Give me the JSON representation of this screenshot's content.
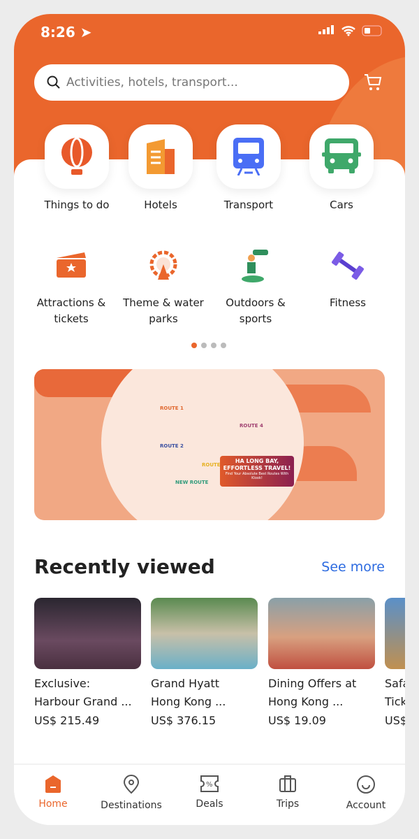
{
  "status": {
    "time": "8:26"
  },
  "search": {
    "placeholder": "Activities, hotels, transport..."
  },
  "categories": [
    {
      "label": "Things to do",
      "icon": "hot-air-balloon-icon"
    },
    {
      "label": "Hotels",
      "icon": "building-icon"
    },
    {
      "label": "Transport",
      "icon": "train-icon"
    },
    {
      "label": "Cars",
      "icon": "car-icon"
    }
  ],
  "subcategories": [
    {
      "label": "Attractions & tickets",
      "icon": "ticket-icon"
    },
    {
      "label": "Theme & water parks",
      "icon": "ferris-wheel-icon"
    },
    {
      "label": "Outdoors & sports",
      "icon": "binoculars-icon"
    },
    {
      "label": "Fitness",
      "icon": "dumbbell-icon"
    }
  ],
  "carousel": {
    "pages": 4,
    "active": 0
  },
  "banner": {
    "route1": "ROUTE 1",
    "route2": "ROUTE 2",
    "route3": "ROUTE 3",
    "route4": "ROUTE 4",
    "new_route": "NEW ROUTE",
    "headline": "HA LONG BAY, EFFORTLESS TRAVEL!",
    "subline": "Find Your Absolute Best Routes With Klook!"
  },
  "recent": {
    "title": "Recently viewed",
    "see_more": "See more",
    "items": [
      {
        "title1": "Exclusive:",
        "title2": "Harbour Grand ...",
        "price": "US$ 215.49"
      },
      {
        "title1": "Grand Hyatt",
        "title2": "Hong Kong ...",
        "price": "US$ 376.15"
      },
      {
        "title1": "Dining Offers at",
        "title2": "Hong Kong ...",
        "price": "US$ 19.09"
      },
      {
        "title1": "Safari",
        "title2": "Tickets",
        "price": "US$"
      }
    ]
  },
  "nav": [
    {
      "label": "Home",
      "active": true
    },
    {
      "label": "Destinations"
    },
    {
      "label": "Deals"
    },
    {
      "label": "Trips"
    },
    {
      "label": "Account"
    }
  ],
  "colors": {
    "brand": "#ea662c",
    "link": "#2d6be0"
  }
}
